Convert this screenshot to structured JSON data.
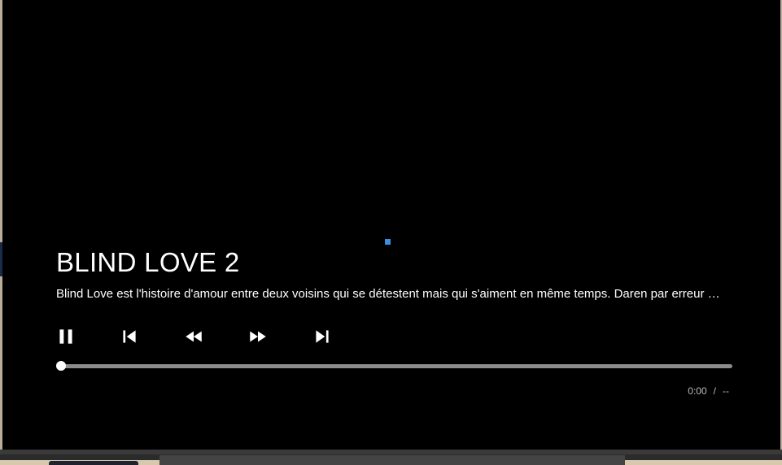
{
  "video": {
    "title": "BLIND LOVE 2",
    "description": "Blind Love est l'histoire d'amour entre deux voisins qui se détestent mais qui s'aiment en même temps. Daren par erreur …"
  },
  "controls": {
    "pause_icon": "pause-icon",
    "previous_icon": "skip-previous-icon",
    "rewind_icon": "rewind-icon",
    "fast_forward_icon": "fast-forward-icon",
    "next_icon": "skip-next-icon"
  },
  "progress": {
    "fraction": 0
  },
  "time": {
    "current": "0:00",
    "separator": "/",
    "duration": "--"
  },
  "colors": {
    "background": "#000000",
    "spinner": "#3b8fe0",
    "text": "#ffffff",
    "track": "#8c8c8c"
  }
}
